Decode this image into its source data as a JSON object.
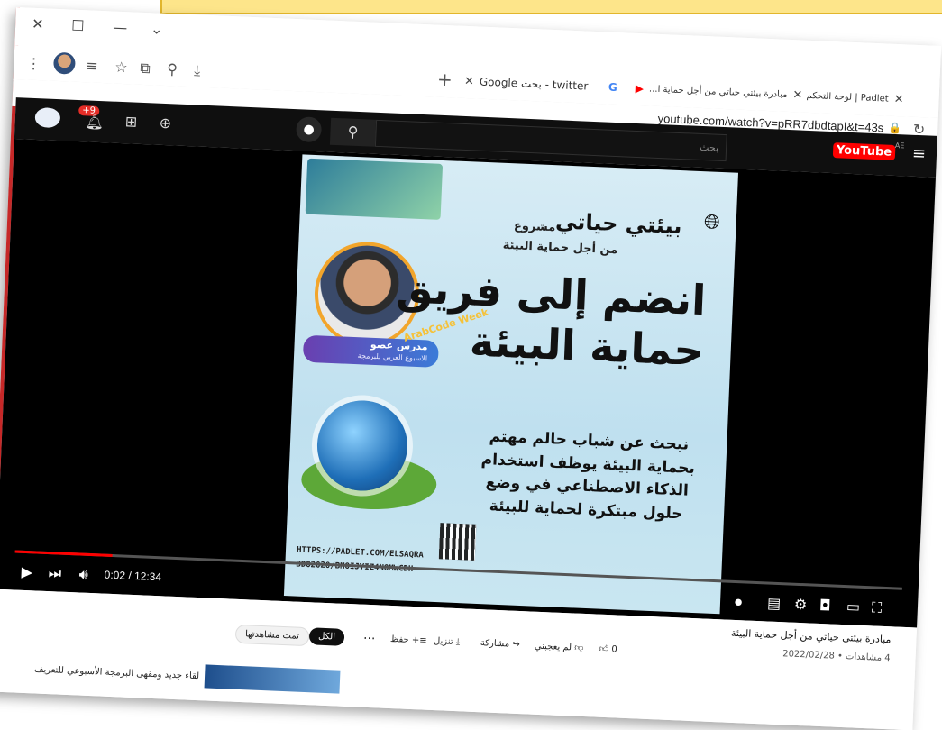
{
  "window": {
    "close": "✕",
    "maximize": "☐",
    "minimize": "—",
    "chevron": "⌄"
  },
  "tabs": [
    {
      "label": "twitter - بحث Google",
      "close": "✕"
    },
    {
      "label": "مبادرة بيئتي حياتي من أجل حماية ا...",
      "close": "✕"
    },
    {
      "label": "Padlet | لوحة التحكم",
      "close": "✕"
    }
  ],
  "new_tab": "+",
  "address": {
    "url": "youtube.com/watch?v=pRR7dbdtapI&t=43s"
  },
  "youtube": {
    "notif_count": "+9",
    "search_placeholder": "بحث",
    "logo": "YouTube",
    "region": "AE"
  },
  "thumbnail": {
    "title": "بيئتي حياتي",
    "project": "مشروع",
    "subtitle": "من أجل حماية البيئة",
    "big1": "انضم إلى فريق",
    "big2": "حماية البيئة",
    "badge_name": "مدرس عضو",
    "badge_sub": "الاسبوع العربي للبرمجة",
    "arab_code": "ArabCode Week",
    "paragraph": "نبحث عن شباب حالم مهتم بحماية البيئة يوظف استخدام الذكاء الاصطناعي في وضع حلول مبتكرة لحماية للبيئة",
    "url1": "HTTPS://PADLET.COM/ELSAQRA",
    "url2": "BDO2020/BNOIJYIZ4NOMWCDH"
  },
  "player": {
    "time": "0:02 / 12:34",
    "progress": 0.11
  },
  "video": {
    "title": "مبادرة بيئتي حياتي من أجل حماية البيئة",
    "meta": "4 مشاهدات • 2022/02/28",
    "likes": "0",
    "dislike": "لم يعجبني",
    "share": "مشاركة",
    "download": "تنزيل",
    "save": "حفظ",
    "more": "...",
    "chip_all": "الكل",
    "chip_watched": "تمت مشاهدتها"
  },
  "recommendation": {
    "title": "لقاء جديد ومقهى البرمجة الأسبوعي للتعريف"
  }
}
